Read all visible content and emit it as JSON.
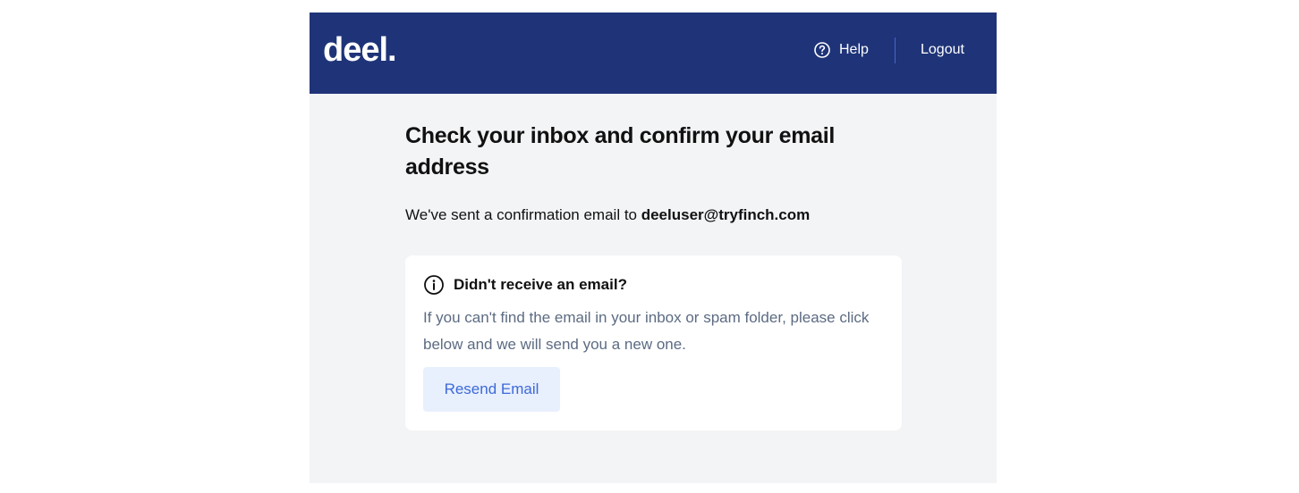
{
  "header": {
    "logo": "deel.",
    "help_label": "Help",
    "logout_label": "Logout",
    "background_color": "#1f3478"
  },
  "main": {
    "title": "Check your inbox and confirm your email address",
    "sent_prefix": "We've sent a confirmation email to ",
    "email": "deeluser@tryfinch.com"
  },
  "card": {
    "icon": "info-icon",
    "title": "Didn't receive an email?",
    "body": "If you can't find the email in your inbox or spam folder, please click below and we will send you a new one.",
    "button_label": "Resend Email",
    "button_color": "#3b6ad8",
    "button_background": "#e8effd"
  }
}
